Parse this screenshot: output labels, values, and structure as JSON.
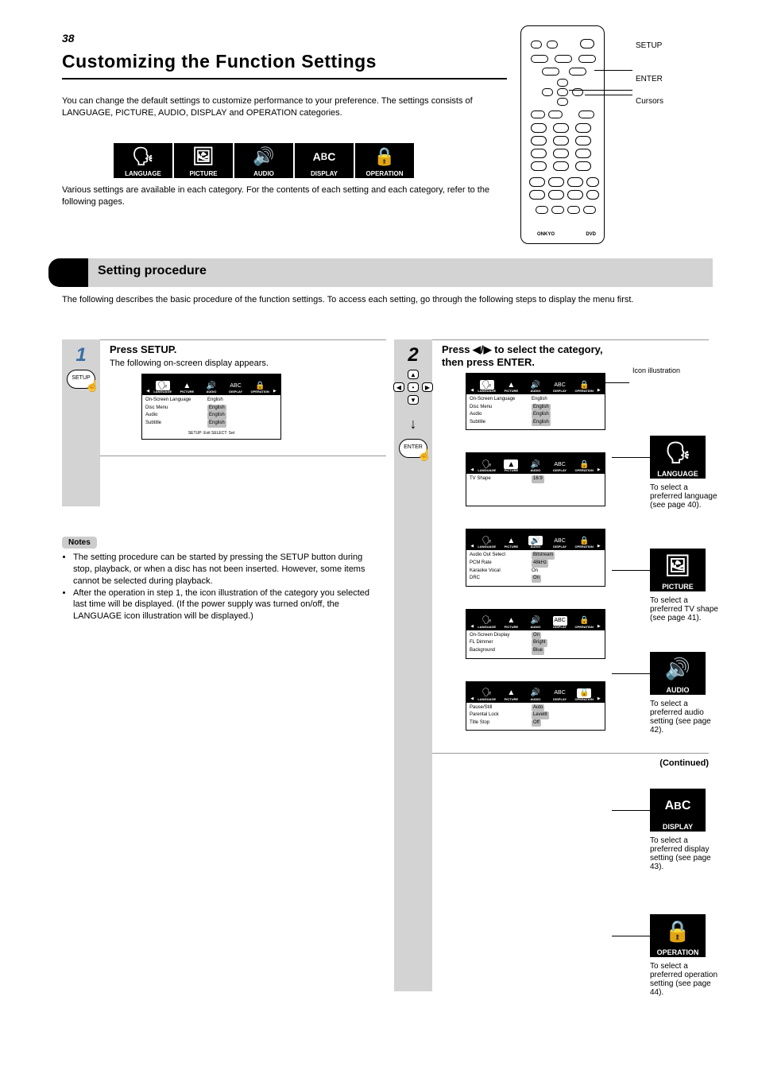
{
  "page_number": "38",
  "title": "Customizing the Function Settings",
  "intro1": "You can change the default settings to customize performance to your preference. The settings consists of LANGUAGE, PICTURE, AUDIO, DISPLAY and OPERATION categories.",
  "intro2": "Various settings are available in each category. For the contents of each setting and each category, refer to the following pages.",
  "remote_labels": {
    "setup": "SETUP",
    "enter": "ENTER",
    "cursors": "Cursors"
  },
  "section_title": "Setting procedure",
  "section_desc": "The following describes the basic procedure of the function settings. To access each setting, go through the following steps to display the menu first.",
  "step1": {
    "num": "1",
    "button": "SETUP",
    "title": "Press SETUP.",
    "body": "The following on-screen display appears."
  },
  "panel_common": {
    "tabs": [
      "LANGUAGE",
      "PICTURE",
      "AUDIO",
      "DISPLAY",
      "OPERATION"
    ]
  },
  "panel_language": {
    "rows": [
      {
        "lbl": "On-Screen Language",
        "val": "English"
      },
      {
        "lbl": "Disc Menu",
        "val": "English",
        "hi": true
      },
      {
        "lbl": "Audio",
        "val": "English",
        "hi": true
      },
      {
        "lbl": "Subtitle",
        "val": "English",
        "hi": true
      }
    ],
    "sel_hint": "SETUP: Exit   SELECT: Set"
  },
  "panel_picture": {
    "rows": [
      {
        "lbl": "TV Shape",
        "val": "16:9",
        "hi": true
      }
    ]
  },
  "panel_audio": {
    "rows": [
      {
        "lbl": "Audio Out Select",
        "val": "Bitstream",
        "hi": true
      },
      {
        "lbl": "PCM Rate",
        "val": "48kHz",
        "hi": true
      },
      {
        "lbl": "Karaoke Vocal",
        "val": "On"
      },
      {
        "lbl": "DRC",
        "val": "On",
        "hi": true
      }
    ]
  },
  "panel_display": {
    "rows": [
      {
        "lbl": "On-Screen Display",
        "val": "On",
        "hi": true
      },
      {
        "lbl": "FL Dimmer",
        "val": "Bright",
        "hi": true
      },
      {
        "lbl": "Background",
        "val": "Blue",
        "hi": true
      }
    ]
  },
  "panel_operation": {
    "rows": [
      {
        "lbl": "Pause/Still",
        "val": "Auto",
        "hi": true
      },
      {
        "lbl": "Parental Lock",
        "val": "Level8",
        "hi": true
      },
      {
        "lbl": "Title Stop",
        "val": "Off",
        "hi": true
      }
    ]
  },
  "notes_title": "Notes",
  "notes": [
    "The setting procedure can be started by pressing the SETUP button during stop, playback, or when a disc has not been inserted. However, some items cannot be selected during playback.",
    "After the operation in step 1, the icon illustration of the category you selected last time will be displayed. (If the power supply was turned on/off, the LANGUAGE icon illustration will be displayed.)"
  ],
  "step2": {
    "num": "2",
    "enter_btn": "ENTER",
    "title_line1": "Press ◀/▶ to select the category,",
    "title_line2": "then press ENTER.",
    "tab_marker": "Icon illustration"
  },
  "cats": {
    "language": {
      "name": "LANGUAGE",
      "desc": "To select a preferred language (see page 40)."
    },
    "picture": {
      "name": "PICTURE",
      "desc": "To select a preferred TV shape (see page 41)."
    },
    "audio": {
      "name": "AUDIO",
      "desc": "To select a preferred audio setting (see page 42)."
    },
    "display": {
      "name": "DISPLAY",
      "desc": "To select a preferred display setting (see page 43)."
    },
    "operation": {
      "name": "OPERATION",
      "desc": "To select a preferred operation setting (see page 44)."
    }
  },
  "continued": "(Continued)"
}
